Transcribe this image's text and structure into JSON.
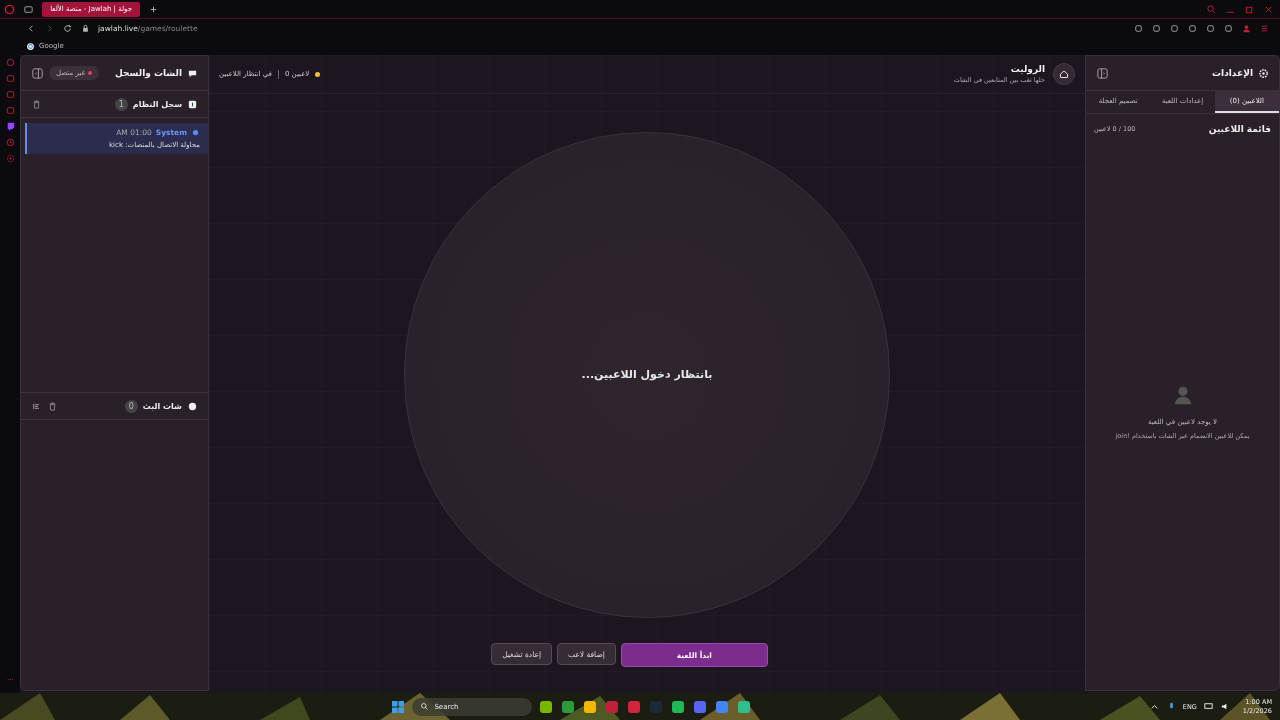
{
  "browser": {
    "tab_title": "جولة | Jawlah - منصة الألعا",
    "url_host": "jawlah.live",
    "url_path": "/games/roulette",
    "bookmark": "Google"
  },
  "chat_panel": {
    "title": "الشات والسجل",
    "status": "غير متصل",
    "connected": false,
    "system_log": {
      "title": "سجل النظام",
      "count": "1",
      "entries": [
        {
          "source": "System",
          "time": "AM 01:00",
          "message": "محاولة الاتصال بالمنصات: kick"
        }
      ]
    },
    "stream_chat": {
      "title": "شات البث",
      "count": "0"
    }
  },
  "game": {
    "title": "الروليت",
    "subtitle": "خلها تقب بين المتابعين في الشات",
    "players": "0 لاعبين",
    "state": "في انتظار اللاعبين",
    "waiting": "بانتظار دخول اللاعبين...",
    "buttons": [
      {
        "label": "ابدأ اللعبة",
        "kind": "primary"
      },
      {
        "label": "إضافة لاعب",
        "kind": "secondary"
      },
      {
        "label": "إعادة تشغيل",
        "kind": "secondary"
      }
    ]
  },
  "settings": {
    "title": "الإعدادات",
    "tabs": [
      {
        "label": "اللاعبين (0)",
        "selected": true
      },
      {
        "label": "إعدادات اللعبة",
        "selected": false
      },
      {
        "label": "تصميم العجلة",
        "selected": false
      }
    ],
    "list_title": "قائمة اللاعبين",
    "capacity": "100 / 0 لاعبين",
    "empty_title": "لا يوجد لاعبين في اللعبة",
    "empty_hint": "يمكن للاعبين الانضمام عبر الشات باستخدام !join"
  },
  "taskbar": {
    "search_placeholder": "Search",
    "language": "ENG",
    "time": "1:00 AM",
    "date": "1/2/2026"
  }
}
